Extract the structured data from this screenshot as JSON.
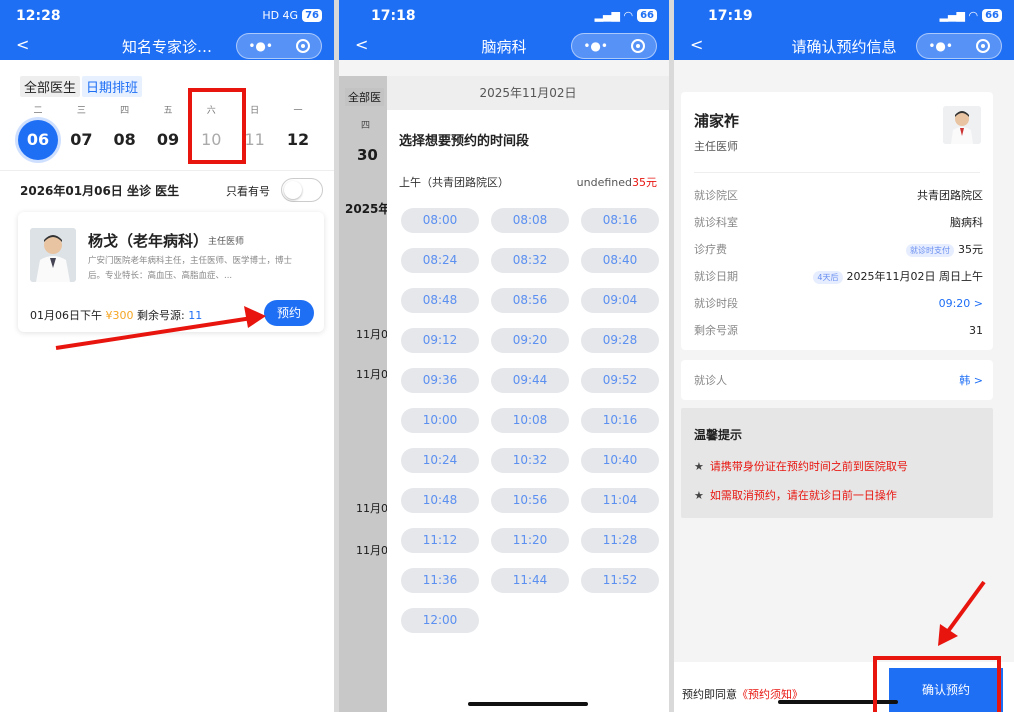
{
  "panel1": {
    "status_time": "12:28",
    "status_icons": "HD 4G",
    "battery": "76",
    "nav_title": "知名专家诊…",
    "back": "<",
    "tabs": [
      "全部医生",
      "日期排班"
    ],
    "weekdays": [
      "二",
      "三",
      "四",
      "五",
      "六",
      "日",
      "一"
    ],
    "dates": [
      "06",
      "07",
      "08",
      "09",
      "10",
      "11",
      "12"
    ],
    "date_line": "2026年01月06日 坐诊 医生",
    "only_available": "只看有号",
    "doctor": {
      "name": "杨戈（老年病科）",
      "title": "主任医师",
      "desc": "广安门医院老年病科主任，主任医师、医学博士，博士后。专业特长：高血压、高脂血症、..."
    },
    "slot": {
      "time": "01月06日下午",
      "price": "¥300",
      "remain_label": "剩余号源:",
      "remain": "11"
    },
    "book_button": "预约"
  },
  "panel2": {
    "status_time": "17:18",
    "battery": "66",
    "nav_title": "脑病科",
    "back": "<",
    "bg_tab": "全部医",
    "bg_week": "四",
    "bg_date": "30",
    "bg_year": "2025年",
    "bg_slots": [
      "11月0",
      "11月0",
      "11月0",
      "11月0"
    ],
    "sheet_date": "2025年11月02日",
    "sheet_title": "选择想要预约的时间段",
    "period": "上午（共青团路院区）",
    "period_price_prefix": "undefined",
    "period_price": "35元",
    "times": [
      "08:00",
      "08:08",
      "08:16",
      "08:24",
      "08:32",
      "08:40",
      "08:48",
      "08:56",
      "09:04",
      "09:12",
      "09:20",
      "09:28",
      "09:36",
      "09:44",
      "09:52",
      "10:00",
      "10:08",
      "10:16",
      "10:24",
      "10:32",
      "10:40",
      "10:48",
      "10:56",
      "11:04",
      "11:12",
      "11:20",
      "11:28",
      "11:36",
      "11:44",
      "11:52",
      "12:00"
    ]
  },
  "panel3": {
    "status_time": "17:19",
    "battery": "66",
    "nav_title": "请确认预约信息",
    "back": "<",
    "doctor_name": "浦家祚",
    "doctor_title": "主任医师",
    "rows": [
      {
        "label": "就诊院区",
        "value": "共青团路院区"
      },
      {
        "label": "就诊科室",
        "value": "脑病科"
      },
      {
        "label": "诊疗费",
        "tag": "就诊时支付",
        "value": "35元"
      },
      {
        "label": "就诊日期",
        "tag": "4天后",
        "value": "2025年11月02日 周日上午"
      },
      {
        "label": "就诊时段",
        "value": "09:20 >"
      },
      {
        "label": "剩余号源",
        "value": "31"
      }
    ],
    "patient_label": "就诊人",
    "patient_value": "韩 >",
    "tips_title": "温馨提示",
    "tips": [
      "请携带身份证在预约时间之前到医院取号",
      "如需取消预约，请在就诊日前一日操作"
    ],
    "agree_prefix": "预约即同意",
    "agree_link": "《预约须知》",
    "confirm_button": "确认预约"
  },
  "colors": {
    "brand": "#1f6ff5",
    "highlight": "#e8150f",
    "price": "#f5a623"
  }
}
